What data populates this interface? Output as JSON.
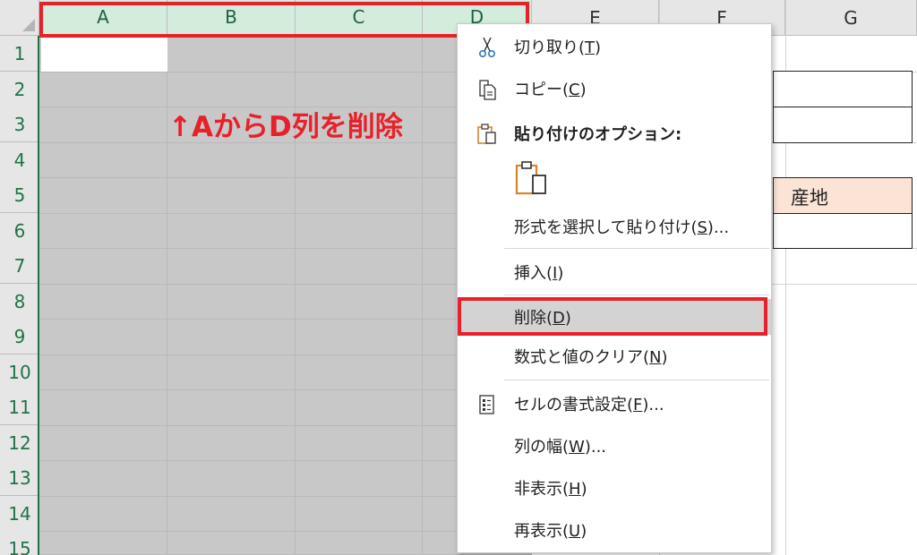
{
  "spreadsheet": {
    "columns": [
      "A",
      "B",
      "C",
      "D",
      "E",
      "F",
      "G"
    ],
    "rows": [
      "1",
      "2",
      "3",
      "4",
      "5",
      "6",
      "7",
      "8",
      "9",
      "10",
      "11",
      "12",
      "13",
      "14",
      "15"
    ],
    "cells": {
      "G5": "産地"
    }
  },
  "annotation": {
    "text": "↑AからD列を削除"
  },
  "context_menu": {
    "items": [
      {
        "id": "cut",
        "label": "切り取り(",
        "hotkey": "T",
        "suffix": ")",
        "icon": "scissors-icon"
      },
      {
        "id": "copy",
        "label": "コピー(",
        "hotkey": "C",
        "suffix": ")",
        "icon": "copy-icon"
      },
      {
        "id": "paste-options",
        "label": "貼り付けのオプション:",
        "icon": "clipboard-icon"
      },
      {
        "id": "paste-special",
        "label": "形式を選択して貼り付け(",
        "hotkey": "S",
        "suffix": ")..."
      },
      {
        "id": "insert",
        "label": "挿入(",
        "hotkey": "I",
        "suffix": ")"
      },
      {
        "id": "delete",
        "label": "削除(",
        "hotkey": "D",
        "suffix": ")"
      },
      {
        "id": "clear",
        "label": "数式と値のクリア(",
        "hotkey": "N",
        "suffix": ")"
      },
      {
        "id": "format-cells",
        "label": "セルの書式設定(",
        "hotkey": "F",
        "suffix": ")...",
        "icon": "format-cells-icon"
      },
      {
        "id": "column-width",
        "label": "列の幅(",
        "hotkey": "W",
        "suffix": ")..."
      },
      {
        "id": "hide",
        "label": "非表示(",
        "hotkey": "H",
        "suffix": ")"
      },
      {
        "id": "unhide",
        "label": "再表示(",
        "hotkey": "U",
        "suffix": ")"
      }
    ],
    "highlighted": "delete"
  },
  "colors": {
    "accent_red": "#e8202a",
    "excel_green": "#217346",
    "selection_gray": "#c8c8c8",
    "peach": "#fbe3d6"
  }
}
